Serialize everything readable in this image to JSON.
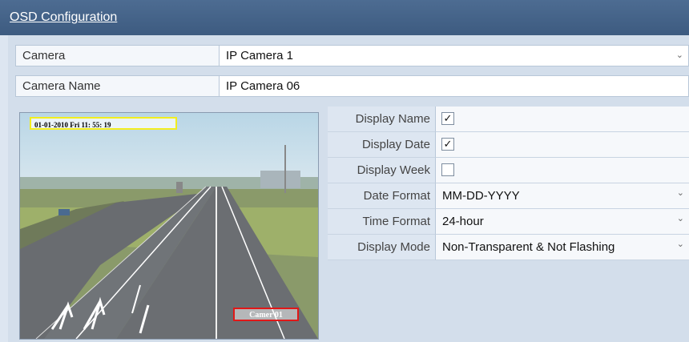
{
  "window": {
    "title": "OSD Configuration"
  },
  "camera": {
    "label": "Camera",
    "value": "IP Camera 1"
  },
  "camera_name": {
    "label": "Camera Name",
    "value": "IP Camera 06"
  },
  "preview": {
    "date_overlay": "01-01-2010  Fri  11: 55: 19",
    "name_overlay": "Camer  01"
  },
  "options": [
    {
      "label": "Display Name",
      "type": "checkbox",
      "checked": true
    },
    {
      "label": "Display Date",
      "type": "checkbox",
      "checked": true
    },
    {
      "label": "Display Week",
      "type": "checkbox",
      "checked": false
    },
    {
      "label": "Date Format",
      "type": "select",
      "value": "MM-DD-YYYY"
    },
    {
      "label": "Time Format",
      "type": "select",
      "value": "24-hour"
    },
    {
      "label": "Display Mode",
      "type": "select",
      "value": "Non-Transparent & Not Flashing"
    }
  ],
  "colors": {
    "title_bar": "#4d6c92",
    "date_box": "#f2ee1f",
    "name_box": "#e11818"
  },
  "icons": {
    "checkbox": "check-mark",
    "dropdown": "chevron-down-icon"
  }
}
